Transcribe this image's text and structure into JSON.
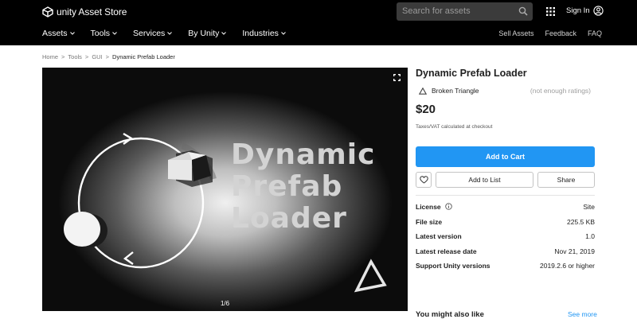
{
  "header": {
    "logo_text": "unity Asset Store",
    "search_placeholder": "Search for assets",
    "sign_in": "Sign In",
    "nav": [
      "Assets",
      "Tools",
      "Services",
      "By Unity",
      "Industries"
    ],
    "nav_right": [
      "Sell Assets",
      "Feedback",
      "FAQ"
    ]
  },
  "breadcrumb": [
    "Home",
    "Tools",
    "GUI",
    "Dynamic Prefab Loader"
  ],
  "hero": {
    "title_lines": [
      "Dynamic",
      "Prefab",
      "Loader"
    ],
    "pager": "1/6"
  },
  "product": {
    "title": "Dynamic Prefab Loader",
    "publisher": "Broken Triangle",
    "ratings": "(not enough ratings)",
    "price": "$20",
    "tax_note": "Taxes/VAT calculated at checkout",
    "add_to_cart": "Add to Cart",
    "add_to_list": "Add to List",
    "share": "Share",
    "specs": [
      {
        "label": "License",
        "value": "Site"
      },
      {
        "label": "File size",
        "value": "225.5 KB"
      },
      {
        "label": "Latest version",
        "value": "1.0"
      },
      {
        "label": "Latest release date",
        "value": "Nov 21, 2019"
      },
      {
        "label": "Support Unity versions",
        "value": "2019.2.6 or higher"
      }
    ]
  },
  "related": {
    "title": "You might also like",
    "see_more": "See more"
  },
  "colors": {
    "accent": "#2196f3",
    "topbar": "#000000"
  }
}
